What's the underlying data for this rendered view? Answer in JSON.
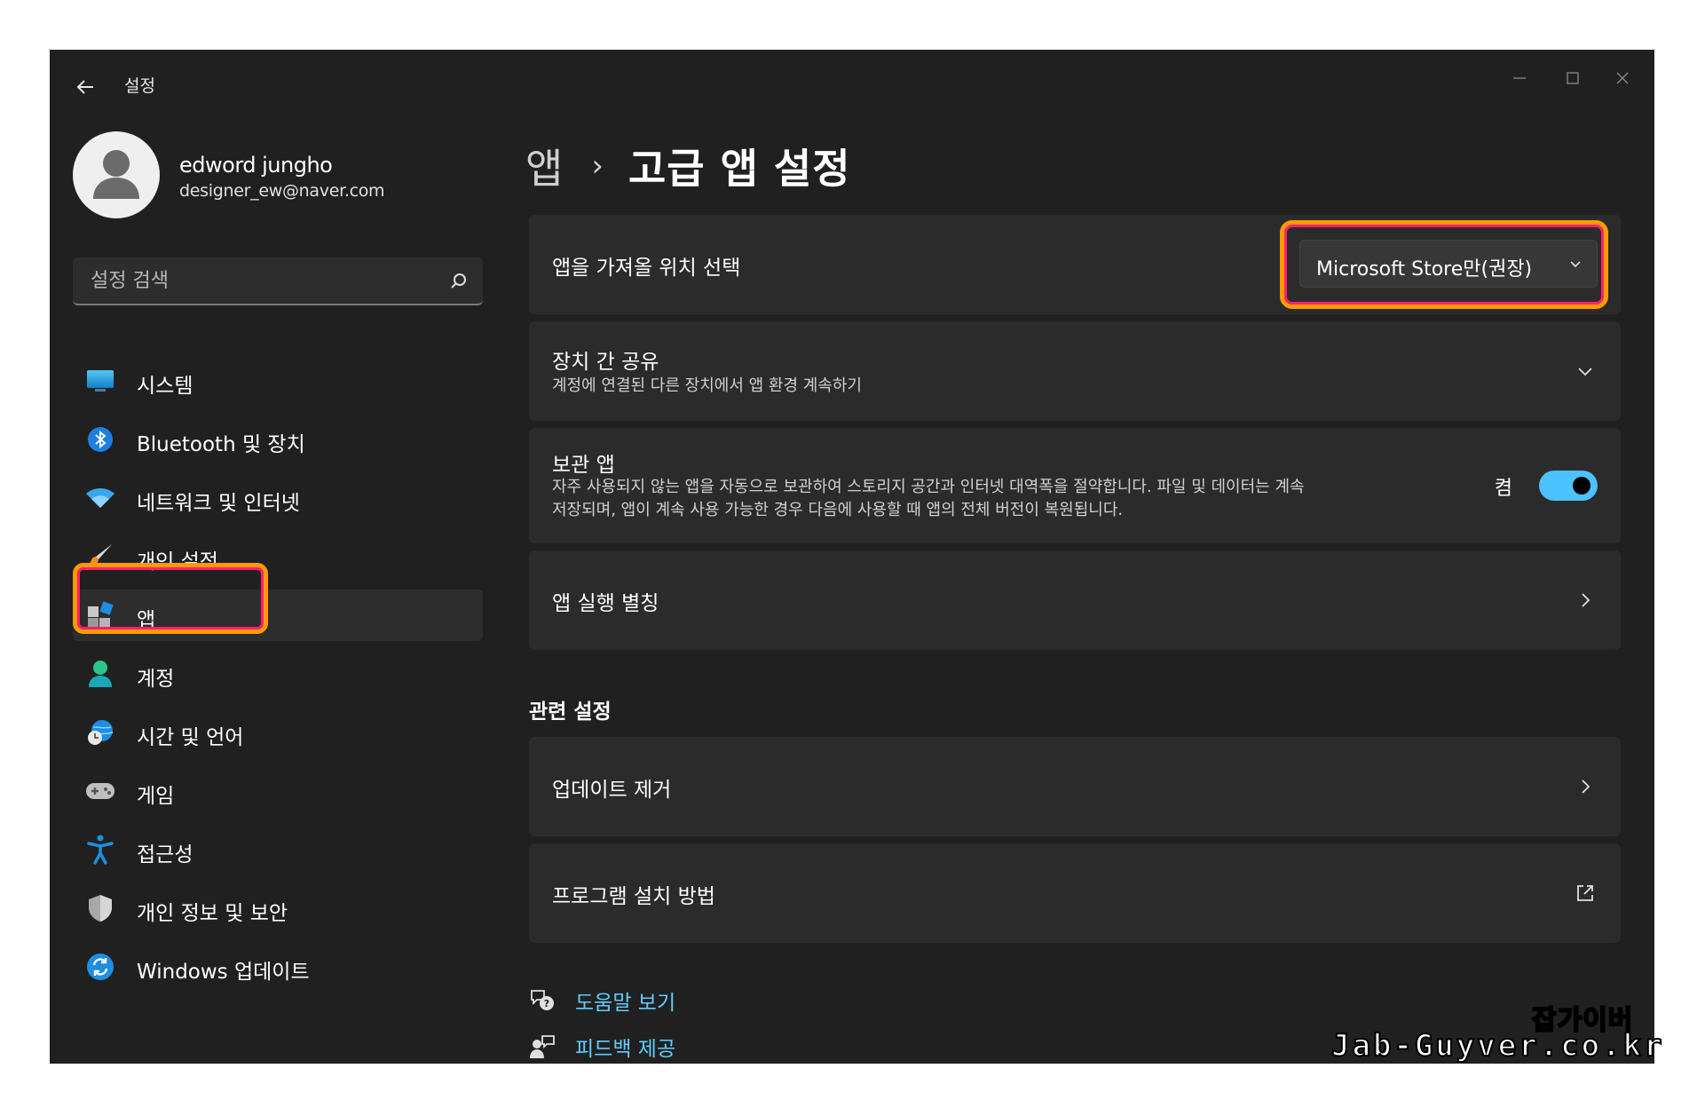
{
  "window": {
    "title": "설정"
  },
  "profile": {
    "name": "edword jungho",
    "email": "designer_ew@naver.com"
  },
  "search": {
    "placeholder": "설정 검색"
  },
  "sidebar": {
    "items": [
      {
        "label": "시스템",
        "icon": "system-icon"
      },
      {
        "label": "Bluetooth 및 장치",
        "icon": "bluetooth-icon"
      },
      {
        "label": "네트워크 및 인터넷",
        "icon": "wifi-icon"
      },
      {
        "label": "개인 설정",
        "icon": "brush-icon"
      },
      {
        "label": "앱",
        "icon": "apps-icon",
        "active": true
      },
      {
        "label": "계정",
        "icon": "person-icon"
      },
      {
        "label": "시간 및 언어",
        "icon": "globe-clock-icon"
      },
      {
        "label": "게임",
        "icon": "gamepad-icon"
      },
      {
        "label": "접근성",
        "icon": "accessibility-icon"
      },
      {
        "label": "개인 정보 및 보안",
        "icon": "shield-icon"
      },
      {
        "label": "Windows 업데이트",
        "icon": "update-icon"
      }
    ]
  },
  "breadcrumb": {
    "parent": "앱",
    "separator": "›",
    "current": "고급 앱 설정"
  },
  "settings": {
    "source": {
      "title": "앱을 가져올 위치 선택",
      "dropdown_value": "Microsoft Store만(권장)"
    },
    "share": {
      "title": "장치 간 공유",
      "desc": "계정에 연결된 다른 장치에서 앱 환경 계속하기"
    },
    "archive": {
      "title": "보관 앱",
      "desc_line1": "자주 사용되지 않는 앱을 자동으로 보관하여 스토리지 공간과 인터넷 대역폭을 절약합니다. 파일 및 데이터는 계속",
      "desc_line2": "저장되며, 앱이 계속 사용 가능한 경우 다음에 사용할 때 앱의 전체 버전이 복원됩니다.",
      "toggle_label": "켬",
      "toggle_on": true
    },
    "alias": {
      "title": "앱 실행 별칭"
    }
  },
  "related": {
    "heading": "관련 설정",
    "uninstall": {
      "title": "업데이트 제거"
    },
    "install_method": {
      "title": "프로그램 설치 방법"
    }
  },
  "help": {
    "get_help": "도움말 보기",
    "feedback": "피드백 제공"
  },
  "watermark": {
    "korean": "잡가이버",
    "domain": "Jab-Guyver.co.kr"
  },
  "colors": {
    "accent": "#4cc2ff",
    "link": "#60cdff",
    "highlight_outer": "#ff9a00",
    "highlight_inner": "#ff1f6e",
    "background": "#202020",
    "card": "#2b2b2b"
  }
}
